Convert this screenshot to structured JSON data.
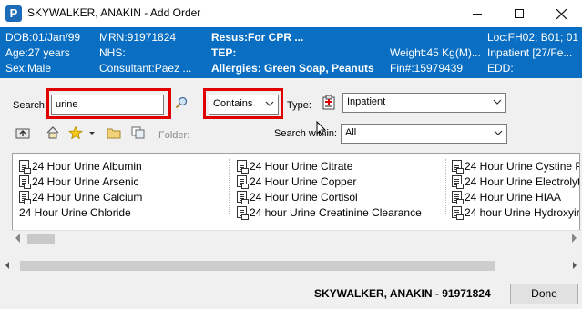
{
  "window": {
    "title": "SKYWALKER, ANAKIN  - Add Order",
    "app_icon_letter": "P"
  },
  "banner": {
    "dob": "DOB:01/Jan/99",
    "mrn": "MRN:91971824",
    "resus": "Resus:For CPR ...",
    "loc": "Loc:FH02; B01; 01",
    "age": "Age:27 years",
    "nhs": "NHS:",
    "tep": "TEP:",
    "weight": "Weight:45 Kg(M)...",
    "inpatient": "Inpatient [27/Fe...",
    "sex": "Sex:Male",
    "consultant": "Consultant:Paez ...",
    "allergies": "Allergies: Green Soap, Peanuts",
    "fin": "Fin#:15979439",
    "edd": "EDD:"
  },
  "search": {
    "label": "Search:",
    "value": "urine",
    "mode_value": "Contains",
    "type_label": "Type:",
    "type_value": "Inpatient",
    "within_label": "Search within:",
    "within_value": "All",
    "folder_label": "Folder:"
  },
  "results": {
    "col1": [
      "24 Hour Urine Albumin",
      "24 Hour Urine Arsenic",
      "24 Hour Urine Calcium",
      "24 Hour Urine Chloride"
    ],
    "col2": [
      "24 Hour Urine Citrate",
      "24 Hour Urine Copper",
      "24 Hour Urine Cortisol",
      "24 hour Urine Creatinine Clearance"
    ],
    "col3": [
      "24 Hour Urine Cystine P",
      "24 Hour Urine Electrolyt",
      "24 Hour Urine HIAA",
      "24 hour Urine Hydroxyir"
    ]
  },
  "footer": {
    "patient": "SKYWALKER, ANAKIN  - 91971824",
    "done_label": "Done"
  },
  "colors": {
    "banner": "#0a6fc2",
    "highlight": "#e00000"
  }
}
